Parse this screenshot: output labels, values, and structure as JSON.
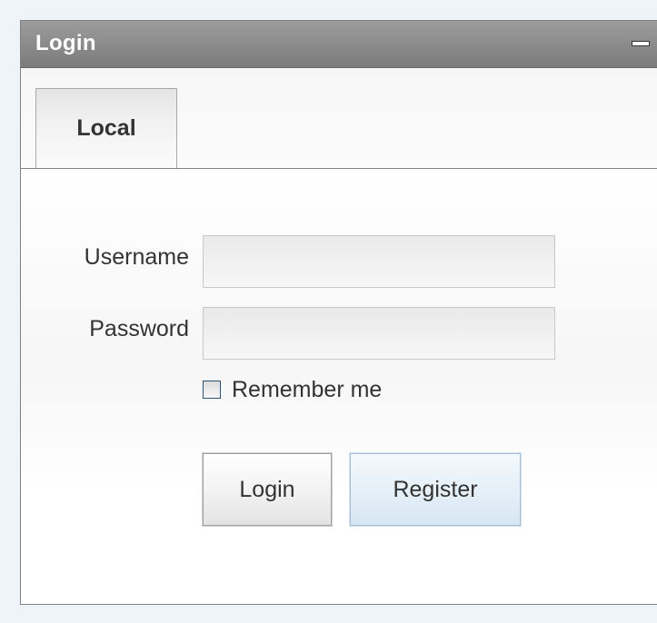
{
  "window": {
    "title": "Login",
    "minimize_icon": "minimize-icon"
  },
  "tabs": [
    {
      "label": "Local",
      "active": true
    }
  ],
  "form": {
    "username_label": "Username",
    "username_value": "",
    "password_label": "Password",
    "password_value": "",
    "remember_label": "Remember me",
    "remember_checked": false,
    "login_button": "Login",
    "register_button": "Register"
  },
  "colors": {
    "titlebar": "#8a8a8a",
    "title_text": "#ffffff",
    "register_accent": "#a8bfd6",
    "checkbox_border": "#2e4f73"
  }
}
